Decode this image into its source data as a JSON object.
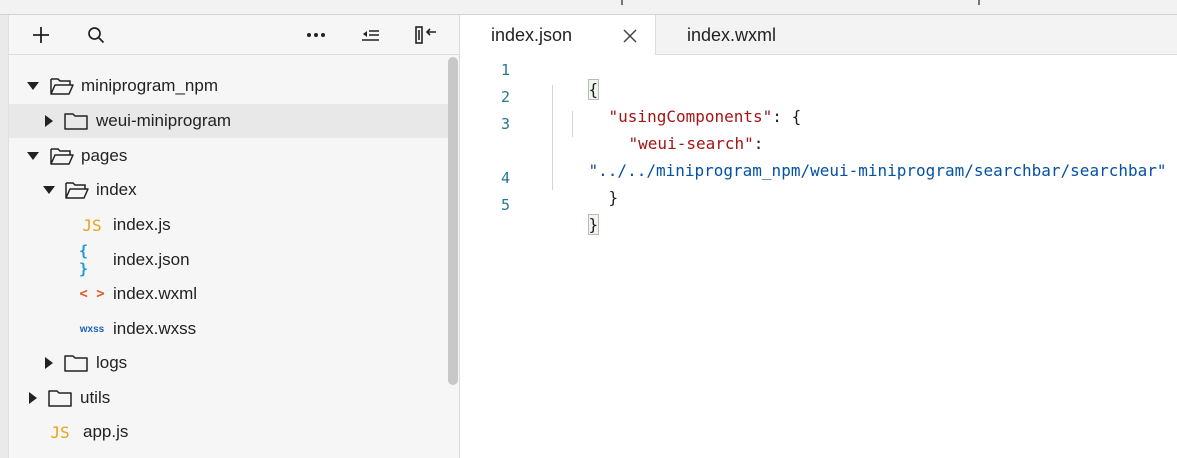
{
  "toolbar": {
    "icons": [
      "plus-icon",
      "search-icon",
      "more-icon",
      "collapse-all-icon",
      "toggle-sidebar-icon"
    ]
  },
  "tree": {
    "items": [
      {
        "label": "miniprogram_npm",
        "type": "folder",
        "expanded": true
      },
      {
        "label": "weui-miniprogram",
        "type": "folder",
        "expanded": false,
        "selected": true
      },
      {
        "label": "pages",
        "type": "folder",
        "expanded": true
      },
      {
        "label": "index",
        "type": "folder",
        "expanded": true
      },
      {
        "label": "index.js",
        "type": "js",
        "icon_text": "JS"
      },
      {
        "label": "index.json",
        "type": "json",
        "icon_text": "{ }"
      },
      {
        "label": "index.wxml",
        "type": "wxml",
        "icon_text": "< >"
      },
      {
        "label": "index.wxss",
        "type": "wxss",
        "icon_text": "wxss"
      },
      {
        "label": "logs",
        "type": "folder",
        "expanded": false
      },
      {
        "label": "utils",
        "type": "folder",
        "expanded": false
      },
      {
        "label": "app.js",
        "type": "js",
        "icon_text": "JS"
      }
    ]
  },
  "tabs": [
    {
      "label": "index.json",
      "active": true
    },
    {
      "label": "index.wxml",
      "active": false
    }
  ],
  "editor": {
    "line_numbers": [
      "1",
      "2",
      "3",
      "4",
      "5"
    ],
    "code": {
      "l1_open": "{",
      "l2_key": "\"usingComponents\"",
      "l2_rest": ": {",
      "l3_key": "\"weui-search\"",
      "l3_rest": ":",
      "l3_value": "\"../../miniprogram_npm/weui-miniprogram/searchbar/searchbar\"",
      "l4_close": "}",
      "l5_close": "}"
    }
  },
  "colors": {
    "js_icon": "#e8a317",
    "json_icon": "#1c9bd6",
    "wxml_icon": "#e0572a",
    "wxss_icon": "#1e63b8",
    "key": "#a31515",
    "string": "#0451a5",
    "line_number": "#237893"
  }
}
